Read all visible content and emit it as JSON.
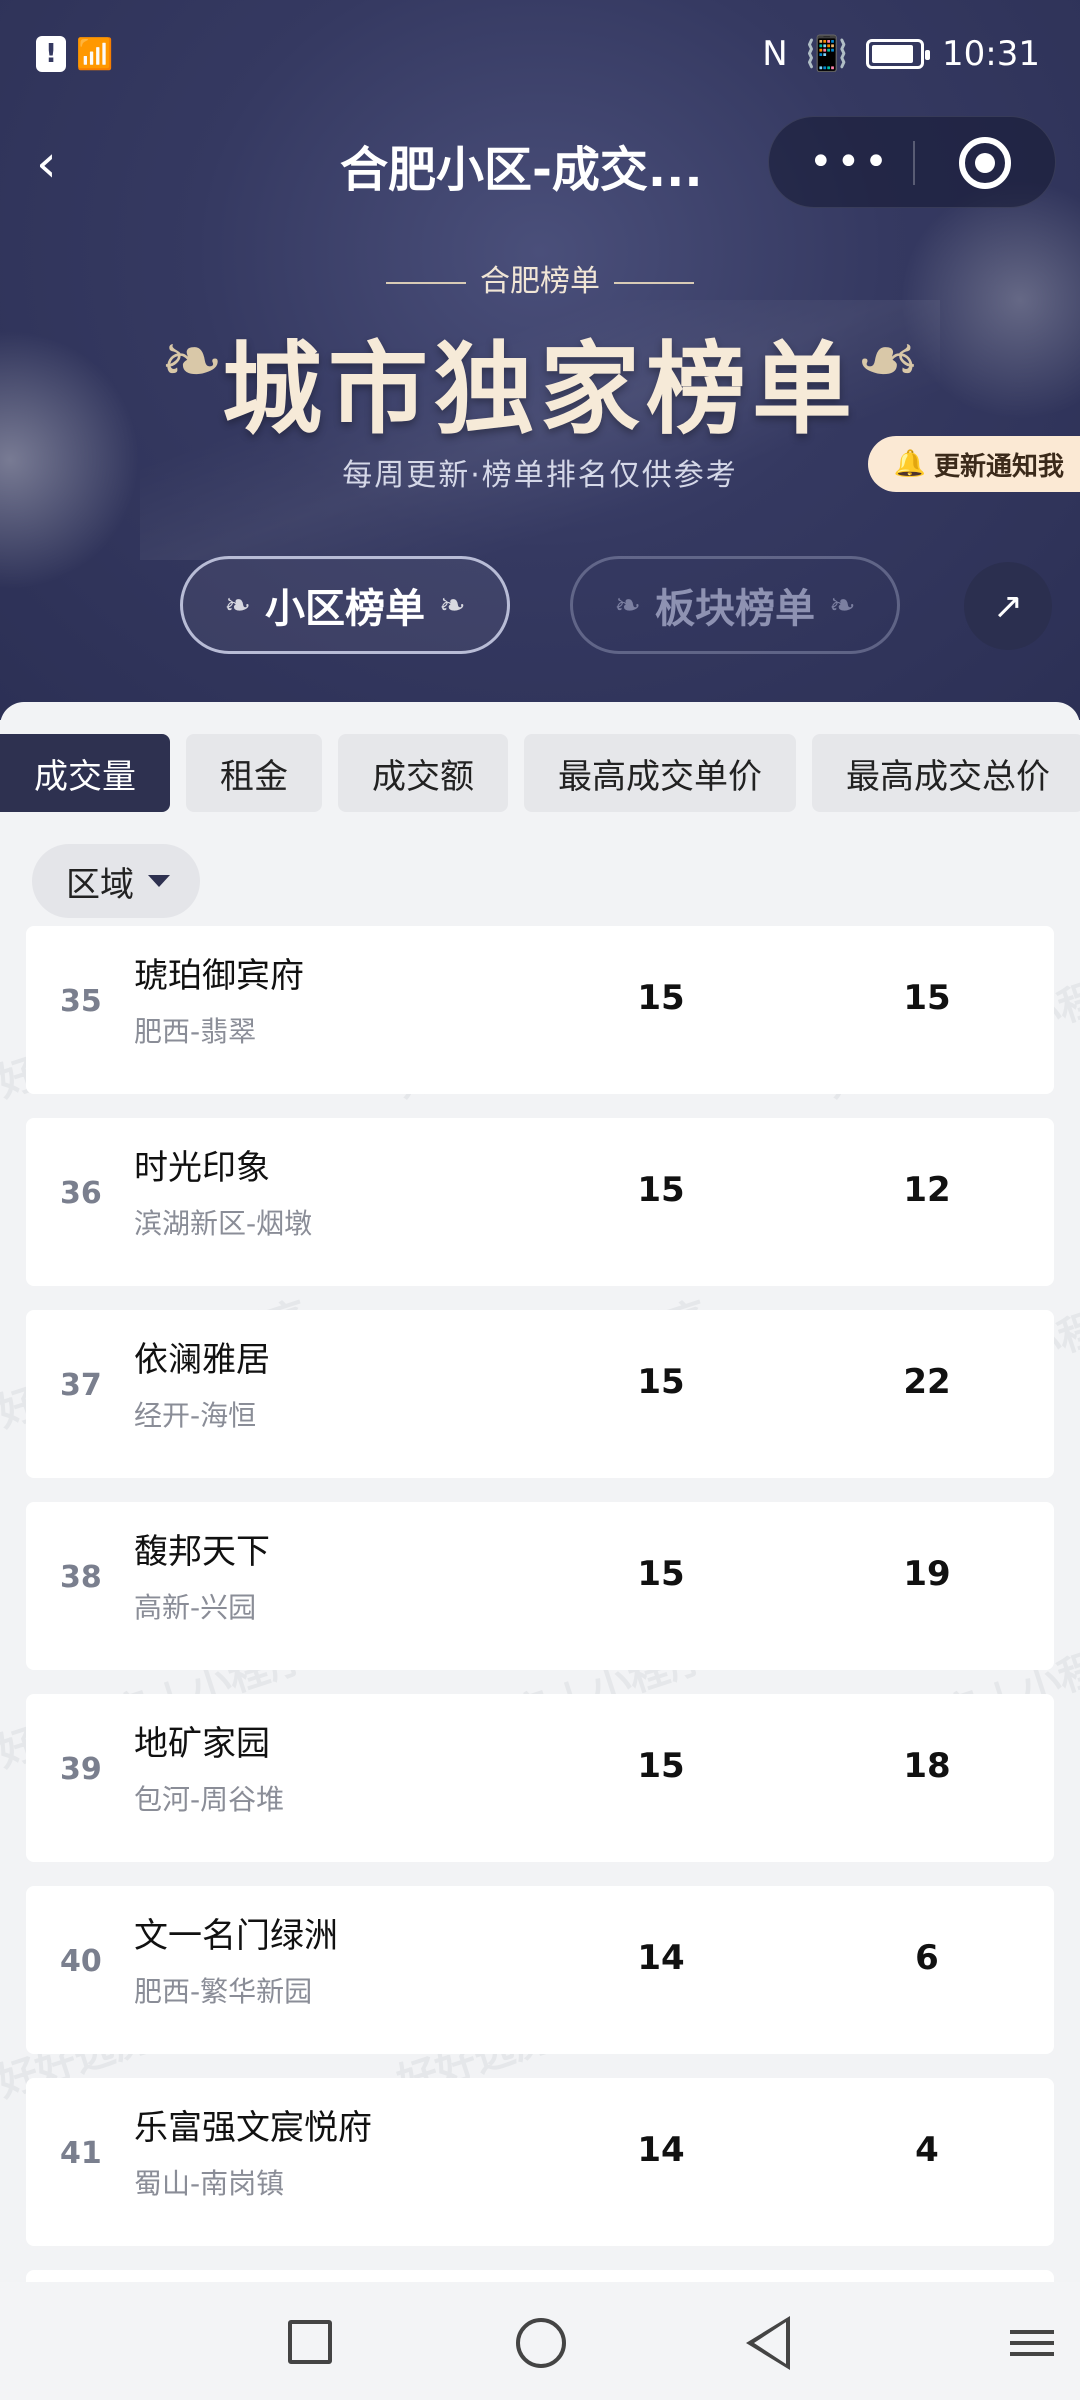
{
  "status": {
    "time": "10:31",
    "battery_level": 0.9
  },
  "nav": {
    "title": "合肥小区-成交...",
    "more_label": "•••"
  },
  "hero": {
    "subtitle": "合肥榜单",
    "title": "城市独家榜单",
    "tagline": "每周更新·榜单排名仅供参考",
    "notify_label": "更新通知我"
  },
  "rank_tabs": [
    {
      "label": "小区榜单",
      "active": true
    },
    {
      "label": "板块榜单",
      "active": false
    }
  ],
  "metric_tabs": [
    {
      "label": "成交量",
      "active": true
    },
    {
      "label": "租金"
    },
    {
      "label": "成交额"
    },
    {
      "label": "最高成交单价"
    },
    {
      "label": "最高成交总价"
    }
  ],
  "filter": {
    "region_label": "区域"
  },
  "rows": [
    {
      "rank": "35",
      "name": "琥珀御宾府",
      "location": "肥西-翡翠",
      "value1": "15",
      "value2": "15"
    },
    {
      "rank": "36",
      "name": "时光印象",
      "location": "滨湖新区-烟墩",
      "value1": "15",
      "value2": "12"
    },
    {
      "rank": "37",
      "name": "依澜雅居",
      "location": "经开-海恒",
      "value1": "15",
      "value2": "22"
    },
    {
      "rank": "38",
      "name": "馥邦天下",
      "location": "高新-兴园",
      "value1": "15",
      "value2": "19"
    },
    {
      "rank": "39",
      "name": "地矿家园",
      "location": "包河-周谷堆",
      "value1": "15",
      "value2": "18"
    },
    {
      "rank": "40",
      "name": "文一名门绿洲",
      "location": "肥西-繁华新园",
      "value1": "14",
      "value2": "6"
    },
    {
      "rank": "41",
      "name": "乐富强文宸悦府",
      "location": "蜀山-南岗镇",
      "value1": "14",
      "value2": "4"
    }
  ],
  "watermark_text": "好好选房 | 小程序"
}
